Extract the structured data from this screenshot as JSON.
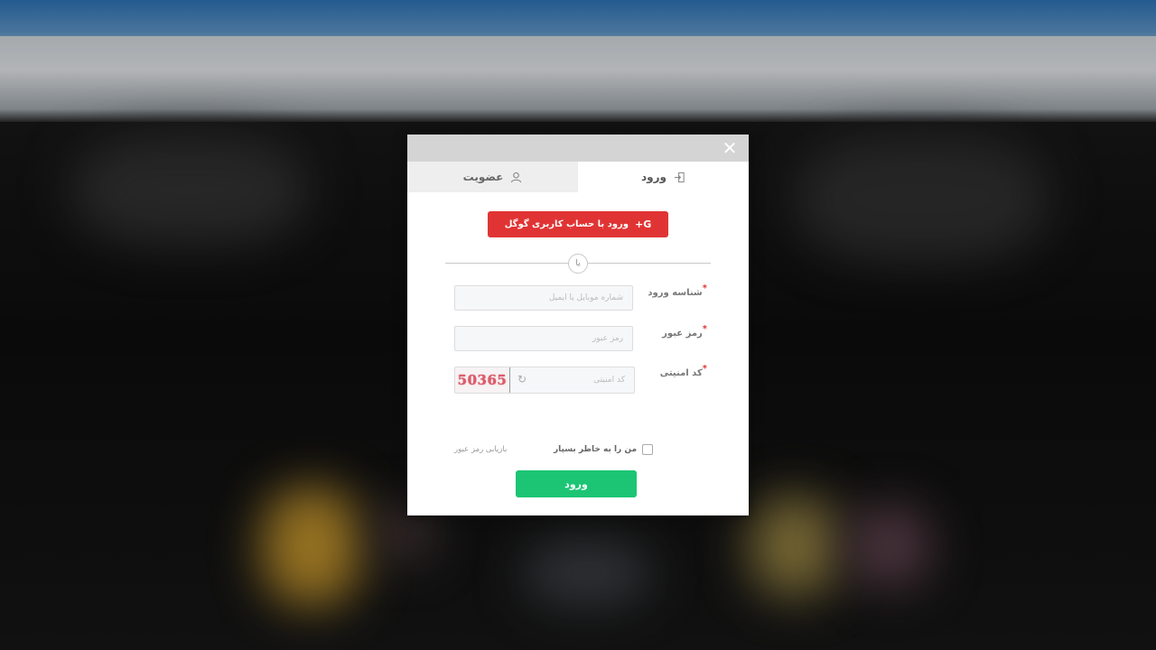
{
  "modal": {
    "tabs": {
      "login_label": "ورود",
      "register_label": "عضویت"
    },
    "google_button_label": "ورود با حساب کاربری گوگل",
    "google_icon_text": "G+",
    "divider_text": "یا",
    "fields": {
      "username_label": "شناسه ورود",
      "username_placeholder": "شماره موبایل یا ایمیل",
      "password_label": "رمز عبور",
      "password_placeholder": "رمز عبور",
      "captcha_label": "کد امنیتی",
      "captcha_placeholder": "کد امنیتی",
      "captcha_code": "50365"
    },
    "required_mark": "*",
    "remember_label": "من را به خاطر بسپار",
    "forgot_label": "بازیابی رمز عبور",
    "submit_label": "ورود"
  },
  "colors": {
    "google_red": "#e03434",
    "submit_green": "#1bc574",
    "header_gray": "#d4d4d4"
  }
}
